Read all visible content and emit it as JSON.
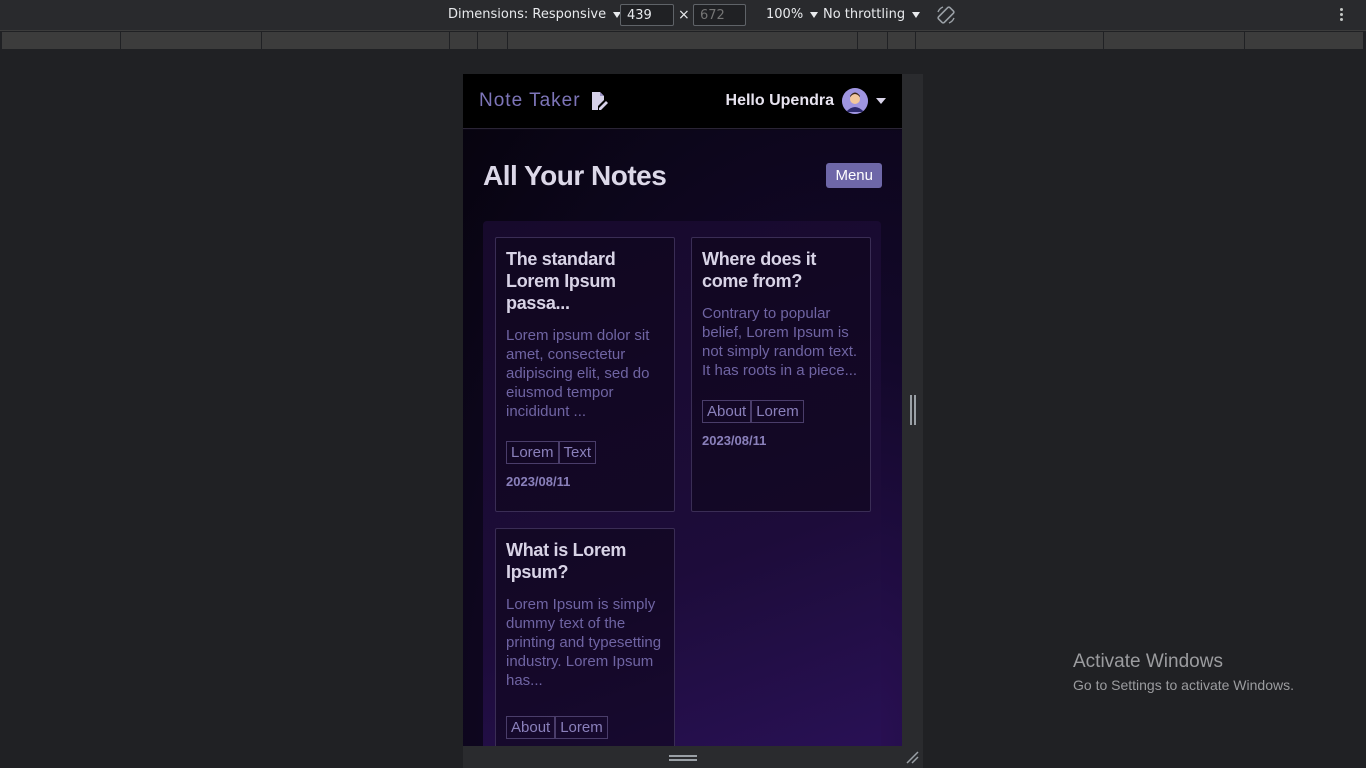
{
  "devtools": {
    "dimensions_label": "Dimensions: Responsive",
    "width_value": "439",
    "height_placeholder": "672",
    "times": "×",
    "zoom": "100%",
    "throttling": "No throttling"
  },
  "app": {
    "brand": "Note Taker",
    "greeting": "Hello Upendra",
    "page_title": "All Your Notes",
    "menu_button": "Menu",
    "notes": [
      {
        "title": "The standard Lorem Ipsum passa...",
        "body": "Lorem ipsum dolor sit amet, consectetur adipiscing elit, sed do eiusmod tempor incididunt ...",
        "tags": [
          "Lorem",
          "Text"
        ],
        "date": "2023/08/11"
      },
      {
        "title": "Where does it come from?",
        "body": "Contrary to popular belief, Lorem Ipsum is not simply random text. It has roots in a piece...",
        "tags": [
          "About",
          "Lorem"
        ],
        "date": "2023/08/11"
      },
      {
        "title": "What is Lorem Ipsum?",
        "body": "Lorem Ipsum is simply dummy text of the printing and typesetting industry. Lorem Ipsum has...",
        "tags": [
          "About",
          "Lorem"
        ],
        "date": ""
      }
    ]
  },
  "watermark": {
    "line1": "Activate Windows",
    "line2": "Go to Settings to activate Windows."
  }
}
